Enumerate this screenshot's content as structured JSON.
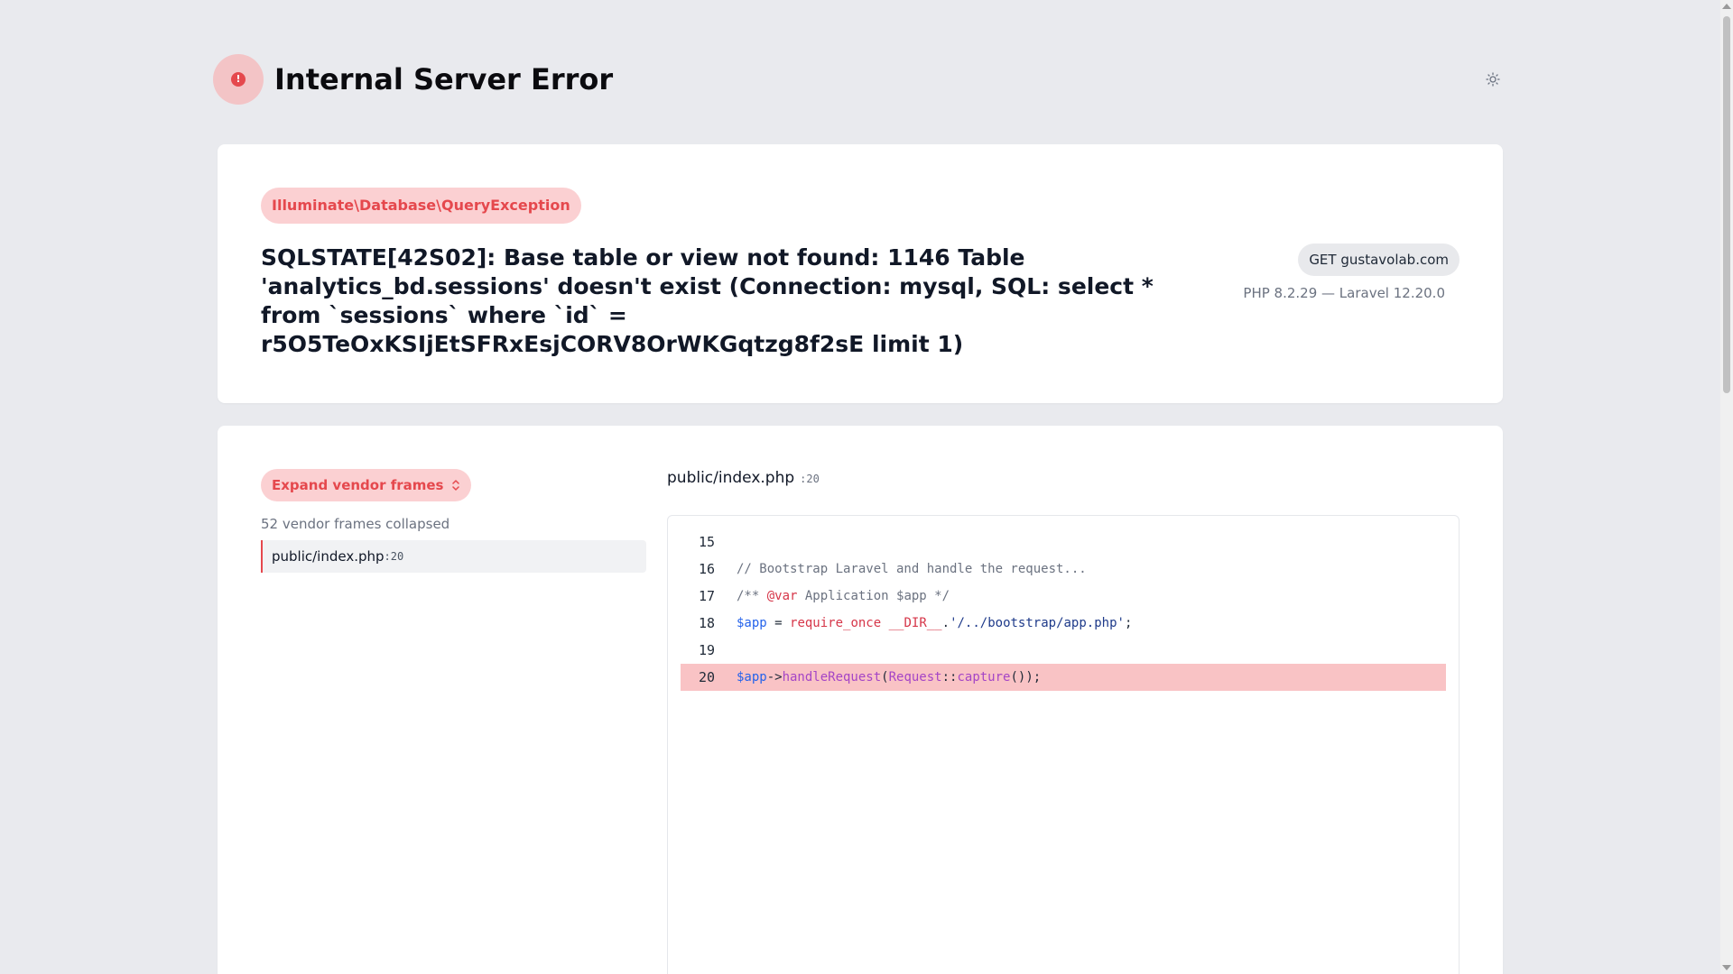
{
  "header": {
    "title": "Internal Server Error",
    "error_icon": "exclamation-circle-icon",
    "theme_icon": "sun-icon"
  },
  "exception": {
    "class": "Illuminate\\Database\\QueryException",
    "message": "SQLSTATE[42S02]: Base table or view not found: 1146 Table 'analytics_bd.sessions' doesn't exist (Connection: mysql, SQL: select * from `sessions` where `id` = r5O5TeOxKSIjEtSFRxEsjCORV8OrWKGqtzg8f2sE limit 1)",
    "request": "GET gustavolab.com",
    "versions": "PHP 8.2.29 — Laravel 12.20.0"
  },
  "trace": {
    "expand_label": "Expand vendor frames",
    "expand_icon": "chevron-up-down-icon",
    "collapsed_note": "52 vendor frames collapsed",
    "frames": [
      {
        "file": "public/index.php",
        "line": ":20"
      }
    ]
  },
  "code_view": {
    "file": "public/index.php",
    "line": ":20",
    "highlight_line": 20,
    "lines": [
      {
        "num": "15",
        "text": ""
      },
      {
        "num": "16",
        "text": "// Bootstrap Laravel and handle the request..."
      },
      {
        "num": "17",
        "text": "/** @var Application $app */"
      },
      {
        "num": "18",
        "text": "$app = require_once __DIR__.'/../bootstrap/app.php';"
      },
      {
        "num": "19",
        "text": ""
      },
      {
        "num": "20",
        "text": "$app->handleRequest(Request::capture());"
      }
    ]
  },
  "colors": {
    "accent": "#e5484d",
    "accent_bg": "#fbd0d2",
    "highlight_bg": "#f9c3c5",
    "page_bg": "#e9eaee"
  }
}
